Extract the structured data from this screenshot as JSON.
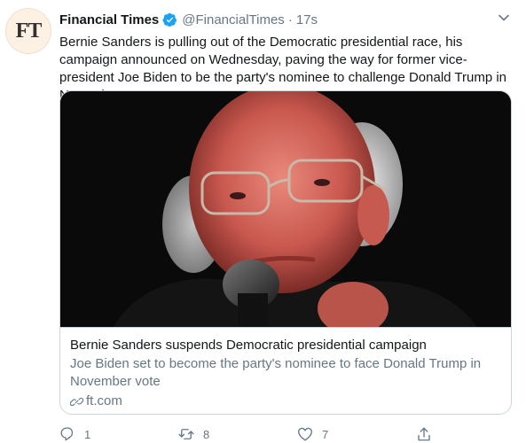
{
  "author": {
    "avatar_text": "FT",
    "name": "Financial Times",
    "handle": "@FinancialTimes",
    "separator": "·",
    "time": "17s"
  },
  "tweet": {
    "text": "Bernie Sanders is pulling out of the Democratic presidential race, his campaign announced on Wednesday, paving the way for former vice-president Joe Biden to be the party's nominee to challenge Donald Trump in November"
  },
  "card": {
    "title": "Bernie Sanders suspends Democratic presidential campaign",
    "description": "Joe Biden set to become the party's nominee to face Donald Trump in November vote",
    "domain": "ft.com",
    "image_alt": "photo of Bernie Sanders speaking into a microphone"
  },
  "actions": {
    "reply_count": "1",
    "retweet_count": "8",
    "like_count": "7"
  },
  "colors": {
    "verified": "#1da1f2",
    "muted": "#657786",
    "border": "#ccd6dd",
    "avatar_bg": "#fdf1e4"
  },
  "icons": [
    "verified-badge-icon",
    "chevron-down-icon",
    "link-icon",
    "reply-icon",
    "retweet-icon",
    "like-icon",
    "share-icon"
  ]
}
